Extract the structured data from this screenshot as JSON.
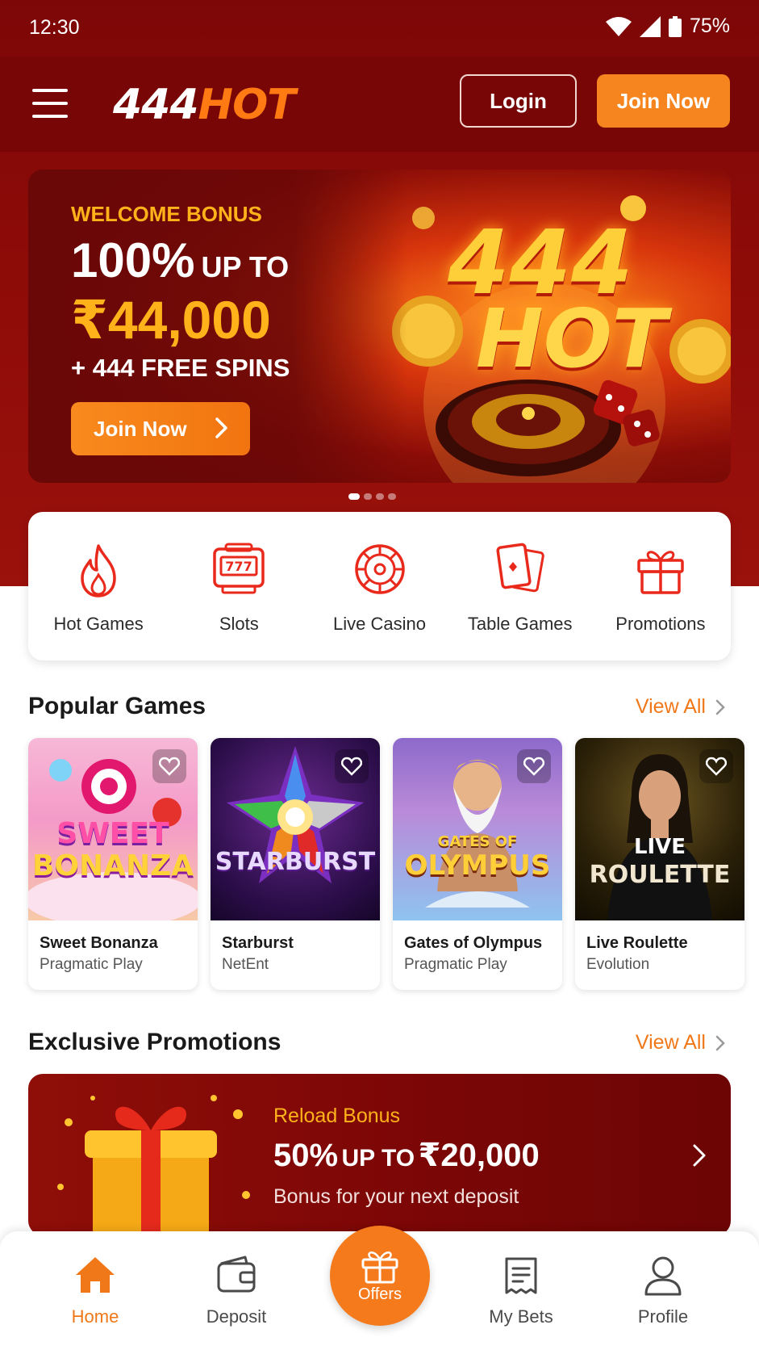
{
  "status_bar": {
    "time": "12:30",
    "battery": "75%"
  },
  "header": {
    "logo_num": "444",
    "logo_hot": "HOT",
    "login_label": "Login",
    "join_label": "Join Now"
  },
  "hero": {
    "kicker": "WELCOME BONUS",
    "percent": "100%",
    "up_to": "UP TO",
    "amount": "₹44,000",
    "spins": "+ 444 FREE SPINS",
    "cta_label": "Join Now",
    "art_line1": "444",
    "art_line2": "HOT",
    "slide_active": 1,
    "slide_count": 4
  },
  "categories": [
    {
      "label": "Hot Games",
      "icon": "flame-icon"
    },
    {
      "label": "Slots",
      "icon": "slot-machine-icon"
    },
    {
      "label": "Live Casino",
      "icon": "roulette-icon"
    },
    {
      "label": "Table Games",
      "icon": "cards-icon"
    },
    {
      "label": "Promotions",
      "icon": "gift-icon"
    }
  ],
  "popular": {
    "title": "Popular Games",
    "view_all": "View All",
    "games": [
      {
        "name": "Sweet Bonanza",
        "provider": "Pragmatic Play",
        "art_line1": "SWEET",
        "art_line2": "BONANZA"
      },
      {
        "name": "Starburst",
        "provider": "NetEnt",
        "art_line1": "STARBURST"
      },
      {
        "name": "Gates of Olympus",
        "provider": "Pragmatic Play",
        "art_line1": "GATES OF",
        "art_line2": "OLYMPUS"
      },
      {
        "name": "Live Roulette",
        "provider": "Evolution",
        "art_line1": "LIVE",
        "art_line2": "ROULETTE"
      }
    ]
  },
  "promotions": {
    "title": "Exclusive Promotions",
    "view_all": "View All",
    "card": {
      "kicker": "Reload Bonus",
      "percent": "50%",
      "up_to": "UP TO",
      "amount": "₹20,000",
      "subtitle": "Bonus for your next deposit"
    }
  },
  "bottom_nav": {
    "home": "Home",
    "deposit": "Deposit",
    "offers": "Offers",
    "my_bets": "My Bets",
    "profile": "Profile"
  },
  "colors": {
    "brand_red": "#7d0707",
    "accent_orange": "#f47a1c",
    "gold": "#ffb21a"
  }
}
